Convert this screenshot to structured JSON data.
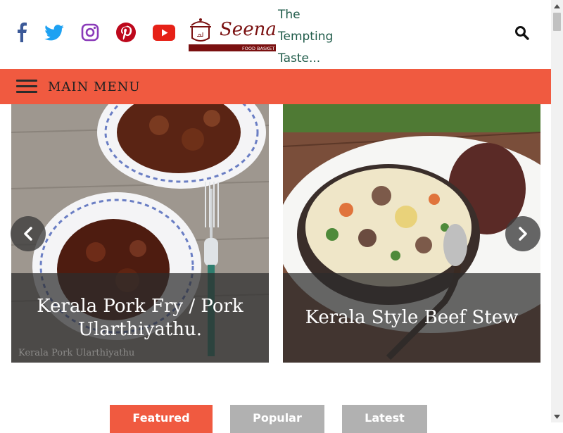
{
  "header": {
    "social": [
      {
        "icon": "facebook-icon",
        "color": "#3b5998"
      },
      {
        "icon": "twitter-icon",
        "color": "#1da1f2"
      },
      {
        "icon": "instagram-icon",
        "color": "#8a3ab9"
      },
      {
        "icon": "pinterest-icon",
        "color": "#bd081c"
      },
      {
        "icon": "youtube-icon",
        "color": "#e62117"
      }
    ],
    "logo": {
      "name": "Seenas",
      "sub": "FOOD BASKET",
      "color": "#7a1010"
    },
    "tagline": "The Tempting Taste..."
  },
  "menu": {
    "label": "MAIN MENU",
    "background": "#f05a40"
  },
  "slider": {
    "slides": [
      {
        "caption": "Kerala Pork Fry / Pork Ularthiyathu.",
        "watermark": "Kerala Pork Ularthiyathu"
      },
      {
        "caption": "Kerala Style Beef Stew"
      }
    ]
  },
  "tabs": [
    {
      "label": "Featured",
      "active": true
    },
    {
      "label": "Popular",
      "active": false
    },
    {
      "label": "Latest",
      "active": false
    }
  ]
}
